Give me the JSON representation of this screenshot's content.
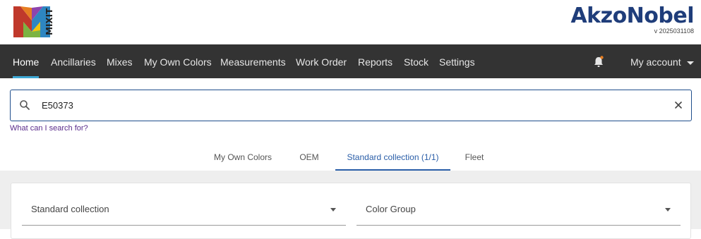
{
  "header": {
    "logo_text": "MIXIT",
    "brand_name": "AkzoNobel",
    "version": "v 2025031108"
  },
  "nav": {
    "items": [
      {
        "label": "Home"
      },
      {
        "label": "Ancillaries"
      },
      {
        "label": "Mixes"
      },
      {
        "label": "My Own Colors"
      },
      {
        "label": "Measurements"
      },
      {
        "label": "Work Order"
      },
      {
        "label": "Reports"
      },
      {
        "label": "Stock"
      },
      {
        "label": "Settings"
      }
    ],
    "active_index": 0,
    "account_label": "My account",
    "notification_icon": "bell-icon"
  },
  "search": {
    "value": "E50373",
    "help_link": "What can I search for?",
    "search_icon": "search-icon",
    "clear_icon": "close-icon"
  },
  "tabs": {
    "items": [
      {
        "label": "My Own Colors"
      },
      {
        "label": "OEM"
      },
      {
        "label": "Standard collection (1/1)"
      },
      {
        "label": "Fleet"
      }
    ],
    "active_index": 2
  },
  "filters": {
    "collection_select": "Standard collection",
    "color_group_select": "Color Group"
  },
  "colors": {
    "nav_bg": "#333333",
    "brand_blue": "#1f3d7a",
    "accent_blue": "#2a5ea8",
    "link_purple": "#5b2d8c"
  }
}
